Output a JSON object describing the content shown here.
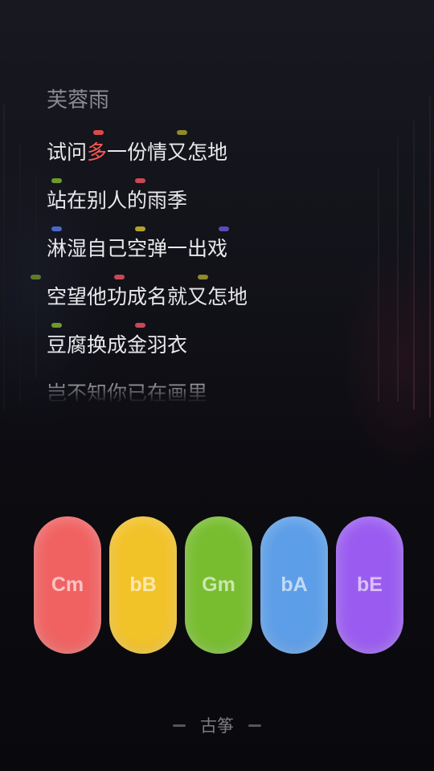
{
  "song": {
    "title": "芙蓉雨"
  },
  "lyrics": [
    {
      "text": "试问多一份情又怎地",
      "highlight_index": 2,
      "highlight_color": "#ff5a55"
    },
    {
      "text": "站在别人的雨季"
    },
    {
      "text": "淋湿自己空弹一出戏"
    },
    {
      "text": "空望他功成名就又怎地"
    },
    {
      "text": "豆腐换成金羽衣"
    },
    {
      "text": "岂不知你已在画里"
    }
  ],
  "chords": [
    {
      "label": "Cm",
      "color": "#f06262"
    },
    {
      "label": "bB",
      "color": "#f2c229"
    },
    {
      "label": "Gm",
      "color": "#77bd2f"
    },
    {
      "label": "bA",
      "color": "#5d9ee8"
    },
    {
      "label": "bE",
      "color": "#9a5cf0"
    }
  ],
  "instrument": {
    "label": "古筝"
  },
  "colors": {
    "background": "#0b0b10",
    "lyric_text": "#e9e9ec",
    "title_text": "#8a8a90",
    "marker_red": "#d94b4b",
    "marker_yellow": "#b3a12a",
    "marker_green": "#6e9a2b",
    "marker_blue": "#4a66c8",
    "marker_purple": "#5a4ab8"
  }
}
